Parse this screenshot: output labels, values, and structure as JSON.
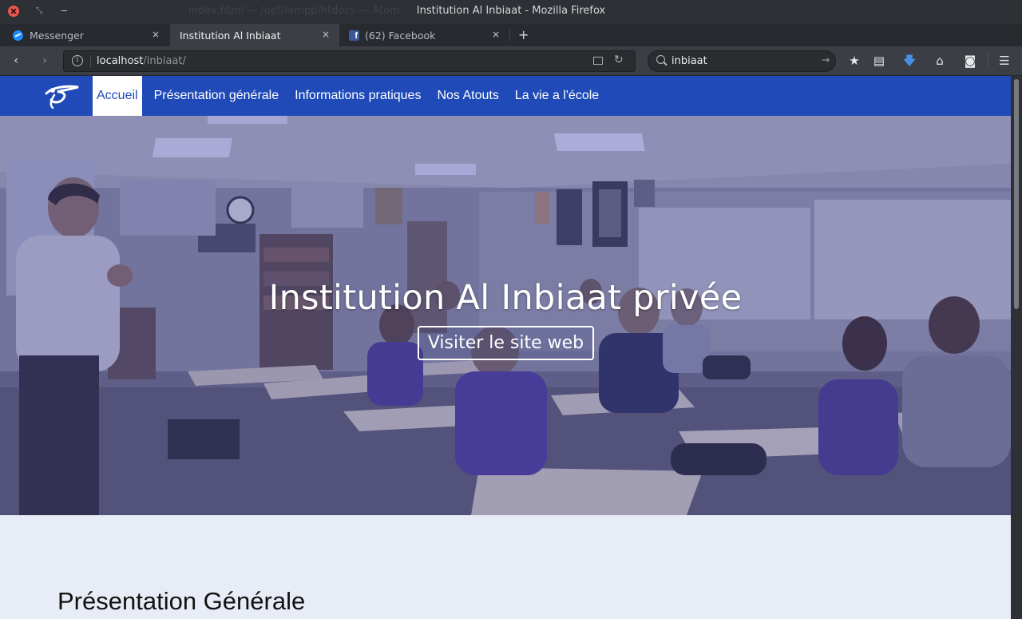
{
  "window": {
    "title": "Institution Al Inbiaat - Mozilla Firefox",
    "background_title": "index.html — /opt/lampp/htdocs — Atom"
  },
  "tabs": [
    {
      "label": "Messenger",
      "icon": "messenger-icon",
      "active": false
    },
    {
      "label": "Institution Al Inbiaat",
      "icon": null,
      "active": true
    },
    {
      "label": "(62) Facebook",
      "icon": "facebook-icon",
      "active": false
    }
  ],
  "tab_close_glyph": "×",
  "new_tab_glyph": "+",
  "navigation": {
    "back_glyph": "‹",
    "forward_glyph": "›",
    "url_host": "localhost",
    "url_path": "/inbiaat/",
    "info_glyph": "i",
    "reload_glyph": "↻",
    "search_value": "inbiaat",
    "search_go_glyph": "→"
  },
  "toolbar_icons": {
    "bookmark": "★",
    "library": "▤",
    "downloads": "🡇",
    "home": "⌂",
    "pocket": "◙",
    "menu": "☰"
  },
  "site": {
    "menu": [
      {
        "label": "Accueil",
        "active": true
      },
      {
        "label": "Présentation générale",
        "active": false
      },
      {
        "label": "Informations pratiques",
        "active": false
      },
      {
        "label": "Nos Atouts",
        "active": false
      },
      {
        "label": "La vie a l'école",
        "active": false
      }
    ],
    "hero": {
      "title": "Institution Al Inbiaat privée",
      "button_label": "Visiter le site web"
    },
    "section_title": "Présentation Générale"
  },
  "colors": {
    "site_nav": "#1f4ab7",
    "hero_overlay": "#3a3f9a",
    "download_icon": "#4a90e2",
    "close_button": "#e9574f"
  }
}
